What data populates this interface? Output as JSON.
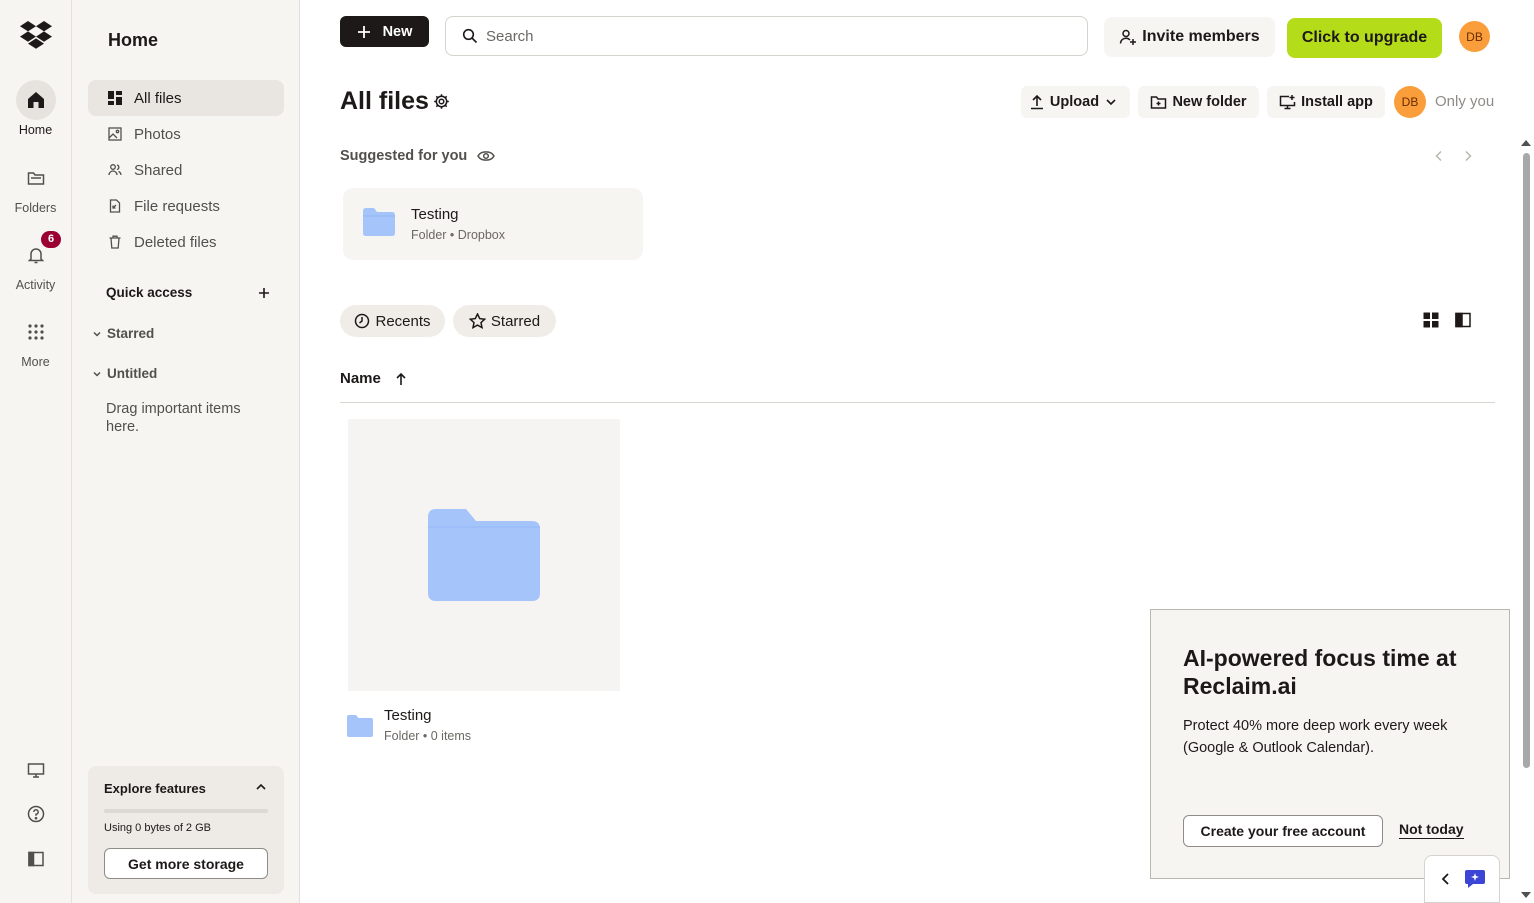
{
  "rail": {
    "items": [
      {
        "label": "Home"
      },
      {
        "label": "Folders"
      },
      {
        "label": "Activity",
        "badge": "6"
      },
      {
        "label": "More"
      }
    ]
  },
  "sidebar": {
    "title": "Home",
    "nav": [
      {
        "label": "All files",
        "icon": "grid-files-icon",
        "active": true
      },
      {
        "label": "Photos",
        "icon": "photo-icon"
      },
      {
        "label": "Shared",
        "icon": "people-icon"
      },
      {
        "label": "File requests",
        "icon": "file-request-icon"
      },
      {
        "label": "Deleted files",
        "icon": "trash-icon"
      }
    ],
    "quick_access": "Quick access",
    "sections": [
      "Starred",
      "Untitled"
    ],
    "drag_hint": "Drag important items here.",
    "explore": {
      "title": "Explore features",
      "usage": "Using 0 bytes of 2 GB",
      "usage_fraction": 0,
      "button": "Get more storage"
    }
  },
  "topbar": {
    "new_label": "New",
    "search_placeholder": "Search",
    "invite_label": "Invite members",
    "upgrade_label": "Click to upgrade",
    "avatar_initials": "DB"
  },
  "header": {
    "title": "All files",
    "upload_label": "Upload",
    "new_folder_label": "New folder",
    "install_app_label": "Install app",
    "avatar_initials": "DB",
    "sharing_label": "Only you"
  },
  "suggested": {
    "title": "Suggested for you",
    "card": {
      "name": "Testing",
      "meta": "Folder • Dropbox"
    }
  },
  "filters": {
    "recents_label": "Recents",
    "starred_label": "Starred"
  },
  "list": {
    "name_header": "Name",
    "items": [
      {
        "name": "Testing",
        "meta": "Folder • 0 items"
      }
    ]
  },
  "promo": {
    "title": "AI-powered focus time at Reclaim.ai",
    "body": "Protect 40% more deep work every week (Google & Outlook Calendar).",
    "cta": "Create your free account",
    "dismiss": "Not today"
  },
  "colors": {
    "accent": "#0061fe",
    "upgrade": "#b4dc19",
    "folder": "#a4c4fa",
    "badge": "#9b0032",
    "avatar": "#fa9e3c"
  }
}
